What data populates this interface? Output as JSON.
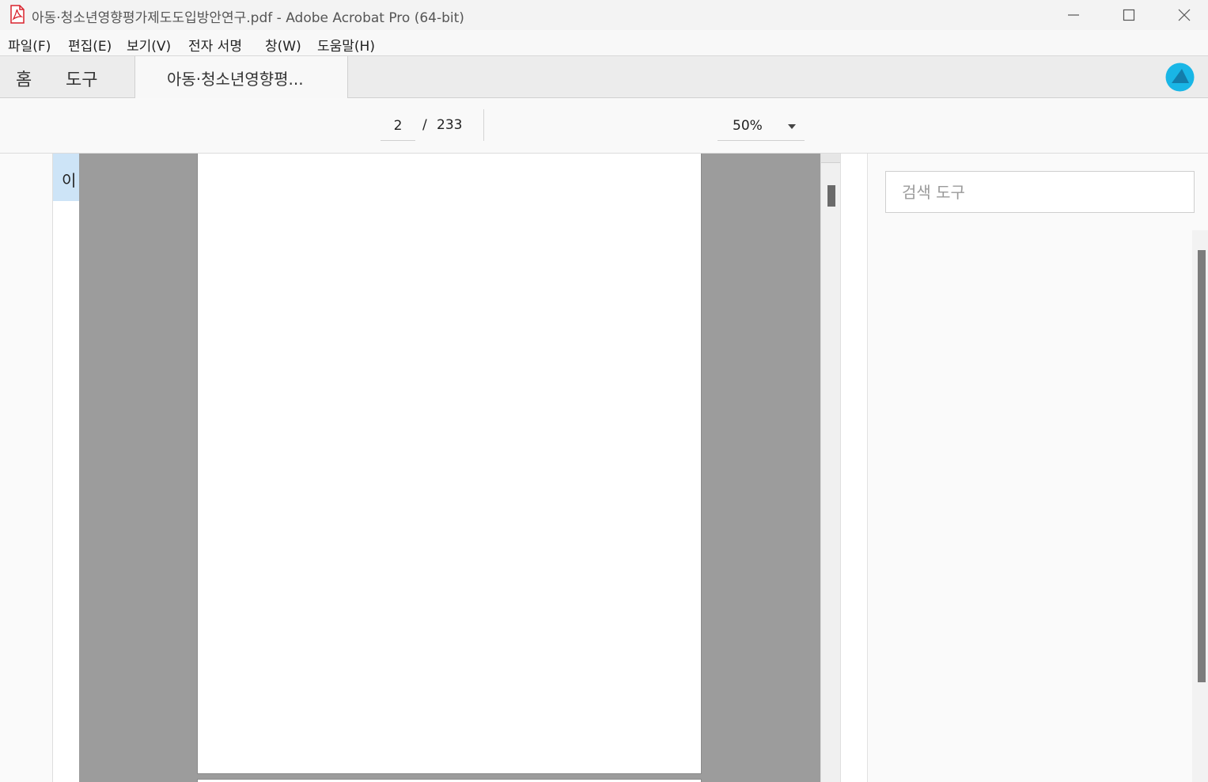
{
  "window": {
    "title": "아동·청소년영향평가제도도입방안연구.pdf - Adobe Acrobat Pro (64-bit)"
  },
  "menu": {
    "items": [
      "파일(F)",
      "편집(E)",
      "보기(V)",
      "전자 서명",
      "창(W)",
      "도움말(H)"
    ]
  },
  "tabs": {
    "home": "홈",
    "tools": "도구",
    "document": "아동·청소년영향평..."
  },
  "toolbar": {
    "current_page": "2",
    "separator": "/",
    "total_pages": "233",
    "zoom": "50%"
  },
  "left_pane": {
    "thumb_label": "이"
  },
  "right_pane": {
    "search_placeholder": "검색 도구"
  },
  "colors": {
    "acrobat_red": "#d9232d",
    "profile_accent": "#19b6e6",
    "doc_background": "#9c9c9c",
    "selection": "#cde4f7"
  },
  "icons": {
    "app": "acrobat-pdf-icon",
    "minimize": "minimize-icon",
    "maximize": "maximize-icon",
    "close": "close-icon",
    "profile": "profile-icon",
    "zoom_dropdown": "chevron-down-icon"
  }
}
